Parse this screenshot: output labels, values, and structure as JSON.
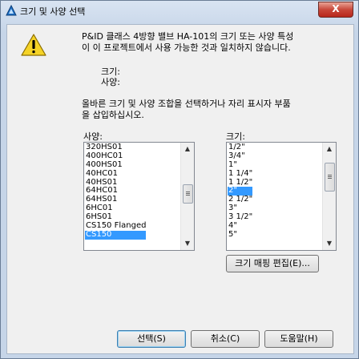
{
  "window": {
    "title": "크기 및 사양 선택",
    "close_label": "X"
  },
  "message": {
    "line1": "P&ID 클래스 4방향 밸브 HA-101의 크기 또는 사양 특성",
    "line2": "이 이 프로젝트에서 사용 가능한 것과 일치하지 않습니다.",
    "size_label": "크기:",
    "spec_label": "사양:",
    "instruction1": "올바른 크기 및 사양 조합을 선택하거나 자리 표시자 부품",
    "instruction2": "을 삽입하십시오."
  },
  "spec_list": {
    "label": "사양:",
    "items": [
      "320HS01",
      "400HC01",
      "400HS01",
      "40HC01",
      "40HS01",
      "64HC01",
      "64HS01",
      "6HC01",
      "6HS01",
      "CS150 Flanged",
      "CS150"
    ],
    "selected_index": 10
  },
  "size_list": {
    "label": "크기:",
    "items": [
      "1/2\"",
      "3/4\"",
      "1\"",
      "1 1/4\"",
      "1 1/2\"",
      "2\"",
      "2 1/2\"",
      "3\"",
      "3 1/2\"",
      "4\"",
      "5\""
    ],
    "selected_index": 5
  },
  "buttons": {
    "edit_size_map": "크기 매핑 편집(E)...",
    "select": "선택(S)",
    "cancel": "취소(C)",
    "help": "도움말(H)"
  }
}
